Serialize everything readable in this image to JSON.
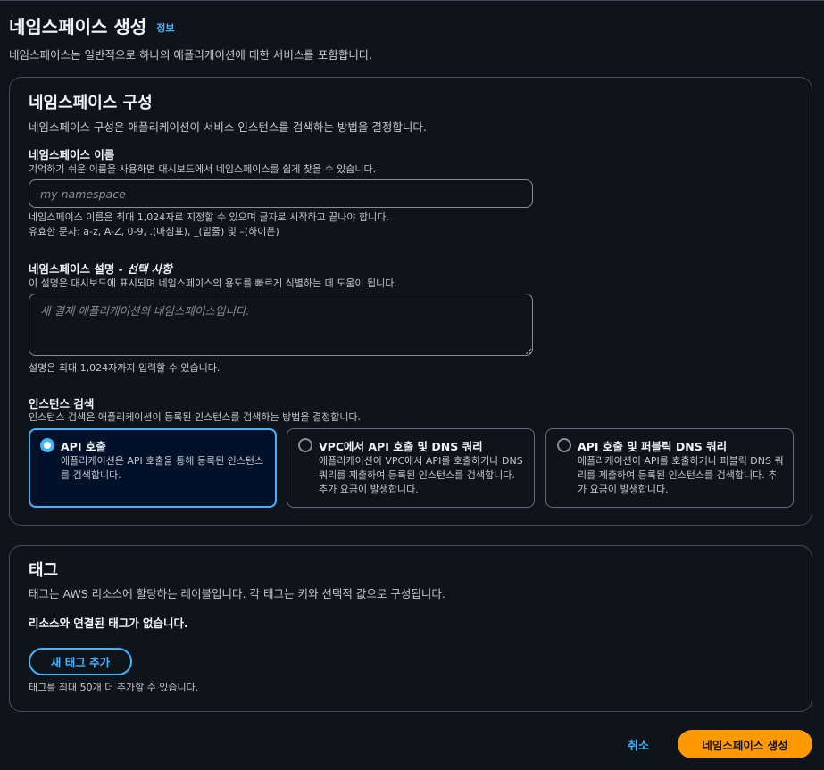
{
  "header": {
    "title": "네임스페이스 생성",
    "info_link": "정보",
    "description": "네임스페이스는 일반적으로 하나의 애플리케이션에 대한 서비스를 포함합니다."
  },
  "config": {
    "title": "네임스페이스 구성",
    "description": "네임스페이스 구성은 애플리케이션이 서비스 인스턴스를 검색하는 방법을 결정합니다.",
    "name_field": {
      "label": "네임스페이스 이름",
      "description": "기억하기 쉬운 이름을 사용하면 대시보드에서 네임스페이스를 쉽게 찾을 수 있습니다.",
      "placeholder": "my-namespace",
      "value": "",
      "constraint_line1": "네임스페이스 이름은 최대 1,024자로 지정할 수 있으며 글자로 시작하고 끝나야 합니다.",
      "constraint_line2": "유효한 문자: a-z, A-Z, 0-9, .(마침표), _(밑줄) 및 –(하이픈)"
    },
    "desc_field": {
      "label": "네임스페이스 설명",
      "label_optional": " - 선택 사항",
      "description": "이 설명은 대시보드에 표시되며 네임스페이스의 용도를 빠르게 식별하는 데 도움이 됩니다.",
      "placeholder": "새 결제 애플리케이션의 네임스페이스입니다.",
      "value": "",
      "constraint": "설명은 최대 1,024자까지 입력할 수 있습니다."
    },
    "discovery": {
      "label": "인스턴스 검색",
      "description": "인스턴스 검색은 애플리케이션이 등록된 인스턴스를 검색하는 방법을 결정합니다.",
      "selected": "api",
      "options": [
        {
          "id": "api",
          "title": "API 호출",
          "description": "애플리케이션은 API 호출을 통해 등록된 인스턴스를 검색합니다."
        },
        {
          "id": "vpc",
          "title": "VPC에서 API 호출 및 DNS 쿼리",
          "description": "애플리케이션이 VPC에서 API를 호출하거나 DNS 쿼리를 제출하여 등록된 인스턴스를 검색합니다. 추가 요금이 발생합니다."
        },
        {
          "id": "public",
          "title": "API 호출 및 퍼블릭 DNS 쿼리",
          "description": "애플리케이션이 API를 호출하거나 퍼블릭 DNS 쿼리를 제출하여 등록된 인스턴스를 검색합니다. 추가 요금이 발생합니다."
        }
      ]
    }
  },
  "tags": {
    "title": "태그",
    "description": "태그는 AWS 리소스에 할당하는 레이블입니다. 각 태그는 키와 선택적 값으로 구성됩니다.",
    "empty_message": "리소스와 연결된 태그가 없습니다.",
    "add_button": "새 태그 추가",
    "limit_text": "태그를 최대 50개 더 추가할 수 있습니다."
  },
  "footer": {
    "cancel_label": "취소",
    "create_label": "네임스페이스 생성"
  },
  "colors": {
    "background": "#0f141a",
    "accent": "#42b4ff",
    "primary_button": "#ff9900",
    "border": "#414d5c"
  }
}
